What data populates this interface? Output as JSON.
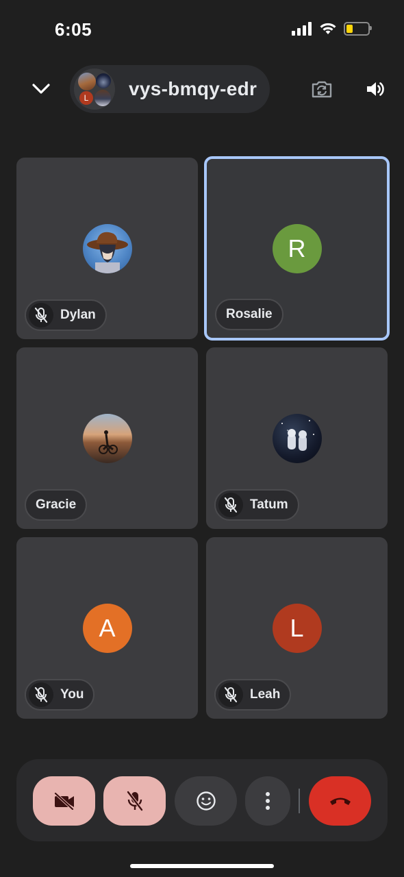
{
  "status_bar": {
    "time": "6:05"
  },
  "header": {
    "meeting_code": "vys-bmqy-edr",
    "cluster_letter": "L",
    "icons": [
      "chevron-down-icon",
      "switch-camera-icon",
      "speaker-icon"
    ]
  },
  "participants": [
    {
      "name": "Dylan",
      "muted": true,
      "avatar_type": "photo",
      "avatar_desc": "cowboy-hat-anime"
    },
    {
      "name": "Rosalie",
      "muted": false,
      "avatar_type": "letter",
      "letter": "R",
      "color": "#6a9a3e",
      "active": true
    },
    {
      "name": "Gracie",
      "muted": false,
      "avatar_type": "photo",
      "avatar_desc": "sunset-cyclist"
    },
    {
      "name": "Tatum",
      "muted": true,
      "avatar_type": "photo",
      "avatar_desc": "astronauts"
    },
    {
      "name": "You",
      "muted": true,
      "avatar_type": "letter",
      "letter": "A",
      "color": "#e37026"
    },
    {
      "name": "Leah",
      "muted": true,
      "avatar_type": "letter",
      "letter": "L",
      "color": "#b03a1f"
    }
  ],
  "controls": {
    "icons": [
      "camera-off-icon",
      "mic-off-icon",
      "emoji-icon",
      "more-vert-icon",
      "end-call-icon"
    ],
    "colors": {
      "off": "#e8b4b0",
      "neutral": "#3c3c3f",
      "end": "#d93025"
    }
  },
  "colors": {
    "background": "#1f1f1f",
    "tile": "#3c3c3f",
    "active_border": "#a8c7fa"
  }
}
